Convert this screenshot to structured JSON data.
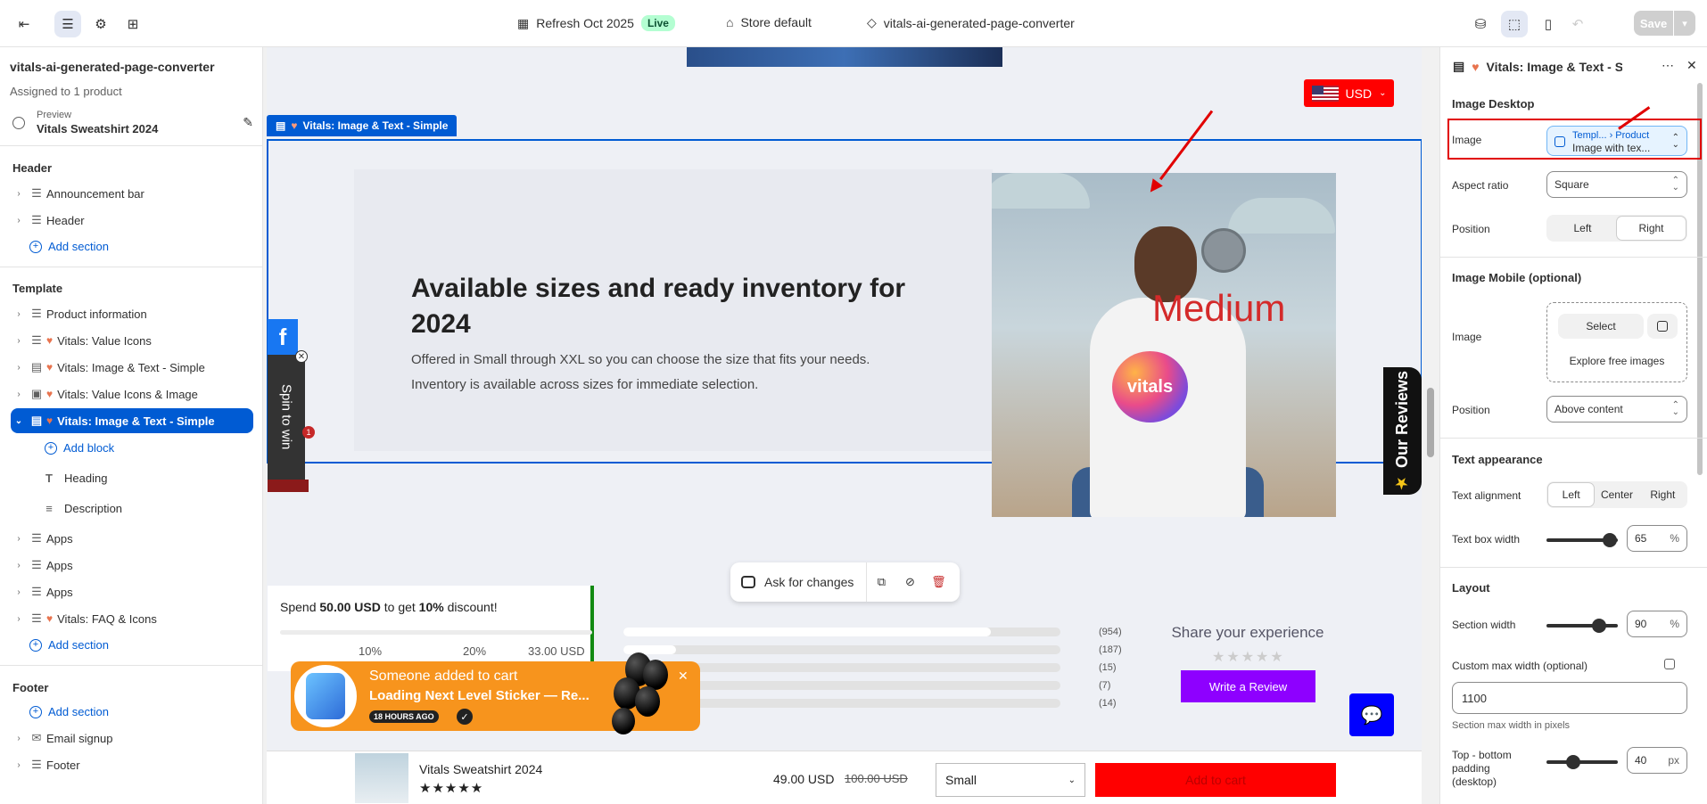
{
  "topbar": {
    "theme_name": "Refresh Oct 2025",
    "live_label": "Live",
    "store": "Store default",
    "template": "vitals-ai-generated-page-converter",
    "save_label": "Save"
  },
  "sidebar": {
    "title": "vitals-ai-generated-page-converter",
    "assigned": "Assigned to 1 product",
    "preview_label": "Preview",
    "preview_value": "Vitals Sweatshirt 2024",
    "header_group": "Header",
    "header_items": [
      "Announcement bar",
      "Header"
    ],
    "add_section": "Add section",
    "template_group": "Template",
    "template_items": [
      {
        "label": "Product information",
        "vitals": false
      },
      {
        "label": "Vitals: Value Icons",
        "vitals": true
      },
      {
        "label": "Vitals: Image & Text - Simple",
        "vitals": true
      },
      {
        "label": "Vitals: Value Icons & Image",
        "vitals": true
      },
      {
        "label": "Vitals: Image & Text - Simple",
        "vitals": true,
        "selected": true
      }
    ],
    "add_block": "Add block",
    "blocks": [
      "Heading",
      "Description"
    ],
    "apps": [
      "Apps",
      "Apps",
      "Apps"
    ],
    "faq": "Vitals: FAQ & Icons",
    "footer_group": "Footer",
    "footer_items": [
      "Email signup",
      "Footer"
    ]
  },
  "canvas": {
    "currency": "USD",
    "section_tag": "Vitals: Image & Text - Simple",
    "heading": "Available sizes and ready inventory for 2024",
    "description": "Offered in Small through XXL so you can choose the size that fits your needs. Inventory is available across sizes for immediate selection.",
    "image_overlay_text": "Medium",
    "image_logo_text": "vitals",
    "spin_label": "Spin to win",
    "spin_badge": "1",
    "reviews_tab": "Our Reviews",
    "ask_label": "Ask for changes",
    "spend": {
      "prefix": "Spend ",
      "amount": "50.00 USD",
      "middle": " to get ",
      "pct": "10%",
      "suffix": " discount!",
      "ticks": [
        "10%",
        "20%",
        "33.00 USD"
      ]
    },
    "rating_counts": [
      "(954)",
      "(187)",
      "(15)",
      "(7)",
      "(14)"
    ],
    "rating_fill": [
      0.84,
      0.12,
      0.05,
      0.02,
      0.03
    ],
    "share_title": "Share your experience",
    "write_review": "Write a Review",
    "toast": {
      "title": "Someone added to cart",
      "product": "Loading Next Level Sticker — Re...",
      "time": "18 HOURS AGO"
    },
    "sticky": {
      "name": "Vitals Sweatshirt 2024",
      "stars": "★★★★★",
      "price": "49.00 USD",
      "old_price": "100.00 USD",
      "size": "Small",
      "add_to_cart": "Add to cart"
    }
  },
  "panel": {
    "title": "Vitals: Image & Text - S...",
    "image_desktop": "Image Desktop",
    "image_label": "Image",
    "image_dyn_path": "Templ... › Product",
    "image_dyn_value": "Image with tex...",
    "aspect_label": "Aspect ratio",
    "aspect_value": "Square",
    "position_label": "Position",
    "position_options": [
      "Left",
      "Right"
    ],
    "image_mobile": "Image Mobile (optional)",
    "mobile_image_label": "Image",
    "select_label": "Select",
    "explore_label": "Explore free images",
    "mobile_position_label": "Position",
    "mobile_position_value": "Above content",
    "text_appearance": "Text appearance",
    "text_alignment_label": "Text alignment",
    "alignment_options": [
      "Left",
      "Center",
      "Right"
    ],
    "text_box_width_label": "Text box width",
    "text_box_width": "65",
    "layout": "Layout",
    "section_width_label": "Section width",
    "section_width": "90",
    "pct_unit": "%",
    "custom_max_label": "Custom max width (optional)",
    "custom_max_value": "1100",
    "custom_max_help": "Section max width in pixels",
    "padding_label": "Top - bottom padding (desktop)",
    "padding_value": "40",
    "px_unit": "px"
  },
  "colors": {
    "accent": "#005bd3",
    "highlight_red": "#e10000",
    "review_btn": "#8e00ff",
    "toast": "#f7941d"
  }
}
